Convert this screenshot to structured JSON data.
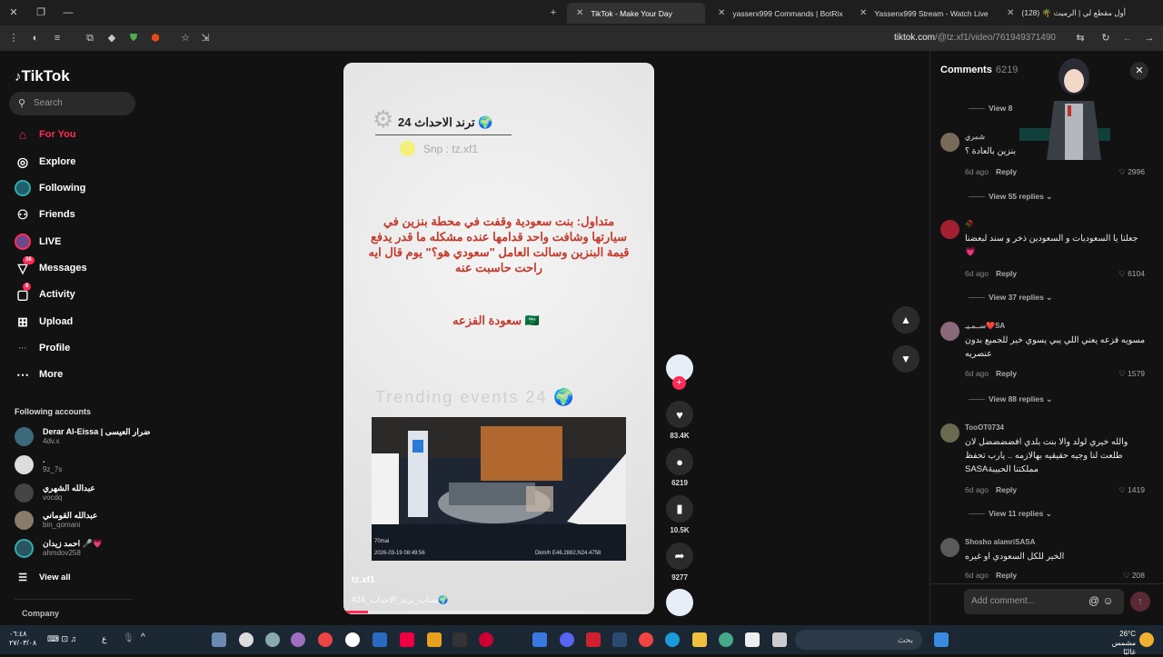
{
  "browser": {
    "tabs": [
      {
        "label": "TikTok - Make Your Day",
        "active": true
      },
      {
        "label": "yasserx999 Commands | BotRix",
        "active": false
      },
      {
        "label": "Yassenx999 Stream - Watch Live",
        "active": false
      },
      {
        "label": "(128) 🌴 أول مقطع لي | الرميث",
        "active": false
      }
    ],
    "url_host": "tiktok.com",
    "url_path": "/@tz.xf1/video/761949371490"
  },
  "sidebar": {
    "logo": "TikTok",
    "search_placeholder": "Search",
    "nav": [
      {
        "label": "For You",
        "icon": "home-icon",
        "active": true
      },
      {
        "label": "Explore",
        "icon": "compass-icon"
      },
      {
        "label": "Following",
        "icon": "following-avatar-icon"
      },
      {
        "label": "Friends",
        "icon": "friends-icon"
      },
      {
        "label": "LIVE",
        "icon": "live-icon"
      },
      {
        "label": "Messages",
        "icon": "messages-icon",
        "badge": "36"
      },
      {
        "label": "Activity",
        "icon": "activity-icon",
        "badge": "8"
      },
      {
        "label": "Upload",
        "icon": "upload-icon"
      },
      {
        "label": "Profile",
        "icon": "profile-icon"
      },
      {
        "label": "More",
        "icon": "more-icon"
      }
    ],
    "following_title": "Following accounts",
    "accounts": [
      {
        "name": "Derar Al-Eissa | ضرار العيسى",
        "user": "4dv.x"
      },
      {
        "name": ".",
        "user": "9z_7s"
      },
      {
        "name": "عبدالله الشهري",
        "user": "vocdq"
      },
      {
        "name": "عبدالله القوماني",
        "user": "bin_qomani"
      },
      {
        "name": "احمد زيدان 🎤💗",
        "user": "ahmdov258"
      }
    ],
    "view_all": "View all",
    "company": "Company"
  },
  "video": {
    "overlay_title": "ترند الاحداث 24 🌍",
    "snap": "Snp : tz.xf1",
    "red_text": "متداول: بنت سعودية وقفت في محطة بنزين في سيارتها وشافت واحد قدامها عنده مشكله ما قدر يدفع قيمة البنزين وسالت العامل \"سعودي هو؟\" يوم قال ايه راحت حاسبت عنه",
    "red_sub": "سعودة الفزعه 🇸🇦",
    "watermark": "Trending events 24 🌍",
    "clip_stamp": "2026-03-19 08:49:56",
    "clip_gps": "Dkm/h E46.2882,N24.4758",
    "clip_brand": "70mai",
    "caption_user": "tz.xf1",
    "caption_tag": "#24_سناب_ترند_الاحداث🌍",
    "progress": 0.08
  },
  "actions": {
    "likes": "83.4K",
    "comments": "6219",
    "saves": "10.5K",
    "shares": "9277"
  },
  "comments": {
    "title": "Comments",
    "count": "6219",
    "items": [
      {
        "user": "شمري",
        "text": "بنزين بالعادة ؟",
        "time": "6d ago",
        "reply": "Reply",
        "likes": "2996",
        "view": "View 55 replies"
      },
      {
        "user": "🥀",
        "text": "جعلنا يا السعوديات و السعودين ذخر و سند لبعضنا💗",
        "time": "6d ago",
        "reply": "Reply",
        "likes": "6104",
        "view": "View 37 replies"
      },
      {
        "user": "ســمـيـ❤️SA",
        "text": "مسويه فزعه يعني اللي يبي يسوي خير للجميع بدون عنصريه",
        "time": "6d ago",
        "reply": "Reply",
        "likes": "1579",
        "view": "View 88 replies"
      },
      {
        "user": "TooOT0734",
        "text": "والله خيري لولد والا بنت بلدي افضضضضل لان طلعت لنا وجيه حقيقيه بهالازمه .. يارب تحفظ مملكتنا الحبيبةSASA",
        "time": "6d ago",
        "reply": "Reply",
        "likes": "1419",
        "view": "View 11 replies"
      },
      {
        "user": "Shosho alamriSASA",
        "text": "الخير للكل السعودي او غيره",
        "time": "6d ago",
        "reply": "Reply",
        "likes": "208",
        "view": ""
      }
    ],
    "top_view": "View 8",
    "add_placeholder": "Add comment..."
  },
  "taskbar": {
    "time": "٠٦:٤٨",
    "date": "٢٧/٠٣/٠٨",
    "search": "بحث",
    "temp": "26°C",
    "weather": "مشمس غالبًا",
    "lang": "ع"
  }
}
